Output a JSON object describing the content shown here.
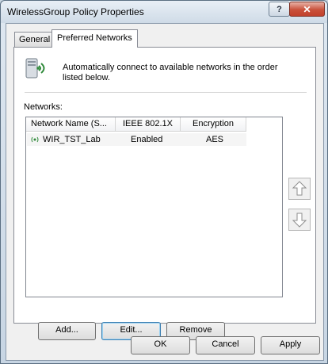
{
  "window": {
    "title": "WirelessGroup Policy Properties"
  },
  "tabs": [
    {
      "label": "General"
    },
    {
      "label": "Preferred Networks"
    }
  ],
  "info": {
    "text": "Automatically connect to available networks in the order listed below."
  },
  "networks": {
    "label": "Networks:",
    "columns": [
      "Network Name (S...",
      "IEEE 802.1X",
      "Encryption"
    ],
    "rows": [
      {
        "name": "WIR_TST_Lab",
        "ieee": "Enabled",
        "encryption": "AES"
      }
    ]
  },
  "panel_buttons": {
    "add": "Add...",
    "edit": "Edit...",
    "remove": "Remove"
  },
  "dialog_buttons": {
    "ok": "OK",
    "cancel": "Cancel",
    "apply": "Apply"
  },
  "colors": {
    "title_bg": "#dfe8f1",
    "close": "#c7412c",
    "panel": "#ffffff"
  }
}
